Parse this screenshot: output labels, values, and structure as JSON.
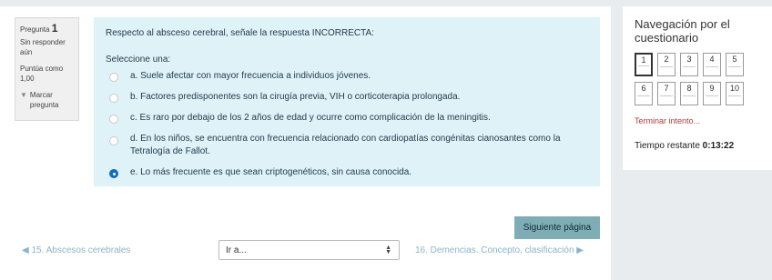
{
  "question_info": {
    "label": "Pregunta",
    "number": "1",
    "state": "Sin responder aún",
    "grade": "Puntúa como 1,00",
    "flag_label": "Marcar pregunta"
  },
  "question": {
    "text": "Respecto al absceso cerebral, señale la respuesta INCORRECTA:",
    "prompt": "Seleccione una:",
    "answers": [
      {
        "label": "a. Suele afectar con mayor frecuencia a individuos jóvenes.",
        "checked": false
      },
      {
        "label": "b. Factores predisponentes son la cirugía previa, VIH o corticoterapia prolongada.",
        "checked": false
      },
      {
        "label": "c. Es raro por debajo de los 2 años de edad y ocurre como complicación de la meningitis.",
        "checked": false
      },
      {
        "label": "d. En los niños, se encuentra con frecuencia relacionado con cardiopatías congénitas cianosantes como la Tetralogía de Fallot.",
        "checked": false
      },
      {
        "label": "e. Lo más frecuente es que sean criptogenéticos, sin causa conocida.",
        "checked": true
      }
    ]
  },
  "buttons": {
    "next_page": "Siguiente página"
  },
  "navigation": {
    "prev_link": "◀ 15. Abscesos cerebrales",
    "jump_label": "Ir a...",
    "next_link": "16. Demencias. Concepto, clasificación ▶"
  },
  "quiz_nav": {
    "title": "Navegación por el cuestionario",
    "questions": [
      "1",
      "2",
      "3",
      "4",
      "5",
      "6",
      "7",
      "8",
      "9",
      "10"
    ],
    "current": "1",
    "finish_link": "Terminar intento...",
    "timer_label": "Tiempo restante",
    "timer_value": "0:13:22"
  },
  "colors": {
    "question_bg": "#def2f8",
    "button_bg": "#7fadb6",
    "finish_link": "#b23a3a",
    "nav_link": "#8ab4c8"
  }
}
